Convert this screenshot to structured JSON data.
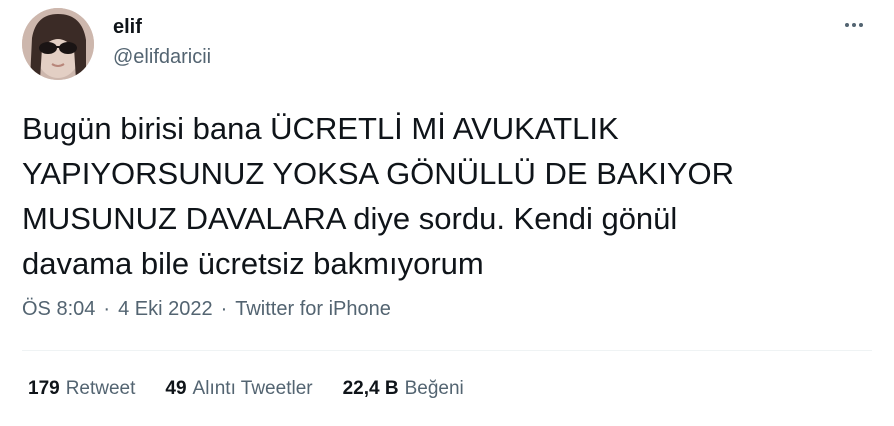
{
  "author": {
    "name": "elif",
    "handle": "@elifdaricii"
  },
  "tweet": {
    "text": "Bugün birisi bana ÜCRETLİ Mİ AVUKATLIK\nYAPIYORSUNUZ YOKSA GÖNÜLLÜ DE BAKIYOR\nMUSUNUZ DAVALARA diye sordu. Kendi gönül\ndavama bile ücretsiz bakmıyorum",
    "time": "ÖS 8:04",
    "date": "4 Eki 2022",
    "source": "Twitter for iPhone",
    "separator": "·"
  },
  "stats": {
    "retweets": {
      "value": "179",
      "label": "Retweet"
    },
    "quotes": {
      "value": "49",
      "label": "Alıntı Tweetler"
    },
    "likes": {
      "value": "22,4 B",
      "label": "Beğeni"
    }
  },
  "icons": {
    "more": "more-options-icon"
  },
  "colors": {
    "primary_text": "#0f1419",
    "secondary_text": "#536471",
    "divider": "#eff3f4"
  }
}
